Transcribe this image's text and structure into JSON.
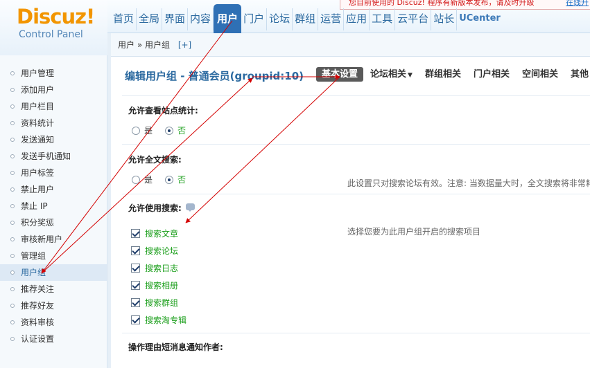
{
  "logo": {
    "name": "Discuz!",
    "subtitle": "Control Panel"
  },
  "notice": {
    "text": "您目前使用的 Discuz! 程序有新版本发布，请及时升级",
    "link": "在线升"
  },
  "nav": [
    "首页",
    "全局",
    "界面",
    "内容",
    "用户",
    "门户",
    "论坛",
    "群组",
    "运营",
    "应用",
    "工具",
    "云平台",
    "站长",
    "UCenter"
  ],
  "nav_active_index": 4,
  "breadcrumb": {
    "path": "用户 » 用户组",
    "add": "[+]"
  },
  "sidebar": {
    "items": [
      "用户管理",
      "添加用户",
      "用户栏目",
      "资料统计",
      "发送通知",
      "发送手机通知",
      "用户标签",
      "禁止用户",
      "禁止 IP",
      "积分奖惩",
      "审核新用户",
      "管理组",
      "用户组",
      "推荐关注",
      "推荐好友",
      "资料审核",
      "认证设置"
    ],
    "active_index": 12
  },
  "main": {
    "title": "编辑用户组 - 普通会员(groupid:10)",
    "tabs": [
      {
        "label": "基本设置",
        "dropdown": false
      },
      {
        "label": "论坛相关",
        "dropdown": true
      },
      {
        "label": "群组相关",
        "dropdown": false
      },
      {
        "label": "门户相关",
        "dropdown": false
      },
      {
        "label": "空间相关",
        "dropdown": false
      },
      {
        "label": "其他",
        "dropdown": true
      }
    ],
    "active_tab_index": 0,
    "settings": {
      "view_stats": {
        "title": "允许查看站点统计:",
        "yes": "是",
        "no": "否",
        "selected": "no"
      },
      "fulltext": {
        "title": "允许全文搜索:",
        "yes": "是",
        "no": "否",
        "selected": "no",
        "description": "此设置只对搜索论坛有效。注意: 当数据量大时，全文搜索将非常耗"
      },
      "search": {
        "title": "允许使用搜索:",
        "description": "选择您要为此用户组开启的搜索项目",
        "options": [
          "搜索文章",
          "搜索论坛",
          "搜索日志",
          "搜索相册",
          "搜索群组",
          "搜索淘专辑"
        ]
      },
      "notify": {
        "title": "操作理由短消息通知作者:"
      }
    }
  },
  "colors": {
    "accent": "#2f70b5",
    "annotation": "#d40000",
    "selected_text": "#1a9e1a"
  }
}
